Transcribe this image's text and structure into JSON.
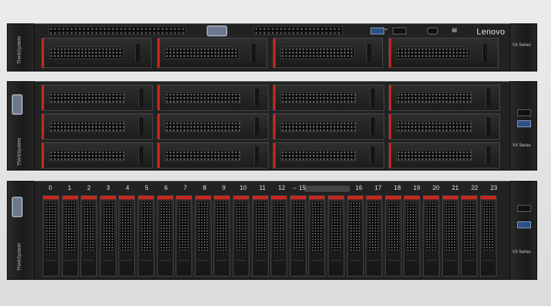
{
  "brand": "Lenovo",
  "series_label": "VX Series",
  "think_label": "ThinkSystem",
  "bay_numbers": [
    "0",
    "1",
    "2",
    "3",
    "4",
    "5",
    "6",
    "7",
    "8",
    "9",
    "10",
    "11",
    "12",
    "15",
    "16",
    "17",
    "18",
    "19",
    "20",
    "21",
    "22",
    "23"
  ],
  "bay_range_separator": "–",
  "colors": {
    "accent_red": "#c8261c",
    "usb3_blue": "#2d4f86",
    "chassis": "#222222",
    "background": "#e2e2e2"
  },
  "icons": [
    "usb-icon",
    "power-button-icon",
    "id-button-icon",
    "vga-port-icon"
  ]
}
